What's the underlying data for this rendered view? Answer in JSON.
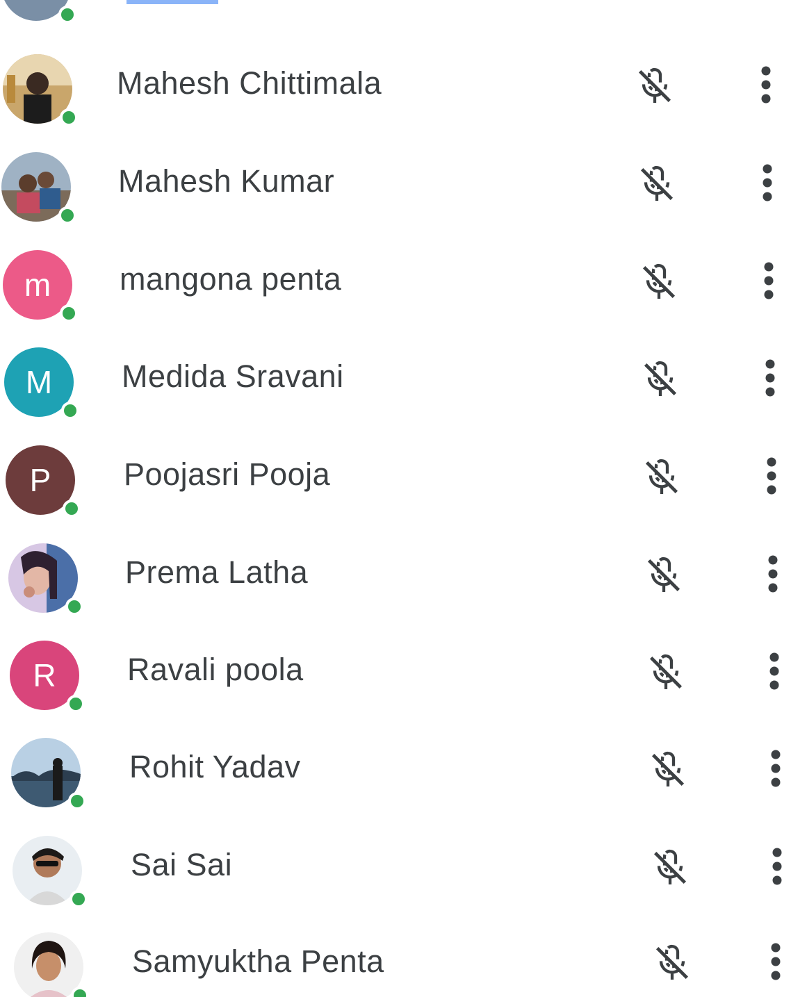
{
  "participants": [
    {
      "name": "Mahesh Chittimala",
      "avatar_type": "photo",
      "avatar_icon": "person-photo-icon",
      "online": true
    },
    {
      "name": "Mahesh Kumar",
      "avatar_type": "photo",
      "avatar_icon": "person-photo-icon",
      "online": true
    },
    {
      "name": "mangona penta",
      "avatar_type": "initial",
      "initial": "m",
      "avatar_color": "#ec5a88",
      "online": true
    },
    {
      "name": "Medida Sravani",
      "avatar_type": "initial",
      "initial": "M",
      "avatar_color": "#1ea2b4",
      "online": true
    },
    {
      "name": "Poojasri Pooja",
      "avatar_type": "initial",
      "initial": "P",
      "avatar_color": "#6d3c3c",
      "online": true
    },
    {
      "name": "Prema Latha",
      "avatar_type": "photo",
      "avatar_icon": "person-photo-icon",
      "online": true
    },
    {
      "name": "Ravali poola",
      "avatar_type": "initial",
      "initial": "R",
      "avatar_color": "#d9457b",
      "online": true
    },
    {
      "name": "Rohit Yadav",
      "avatar_type": "photo",
      "avatar_icon": "person-photo-icon",
      "online": true
    },
    {
      "name": "Sai Sai",
      "avatar_type": "photo",
      "avatar_icon": "person-photo-icon",
      "online": true
    },
    {
      "name": "Samyuktha Penta",
      "avatar_type": "photo",
      "avatar_icon": "person-photo-icon",
      "online": true
    }
  ],
  "icons": {
    "mic": "mic-off-icon",
    "more": "more-vert-icon"
  },
  "colors": {
    "presence": "#34a853",
    "name_text": "#3c4043",
    "icon": "#3c4043",
    "highlight": "#8ab4f8"
  }
}
